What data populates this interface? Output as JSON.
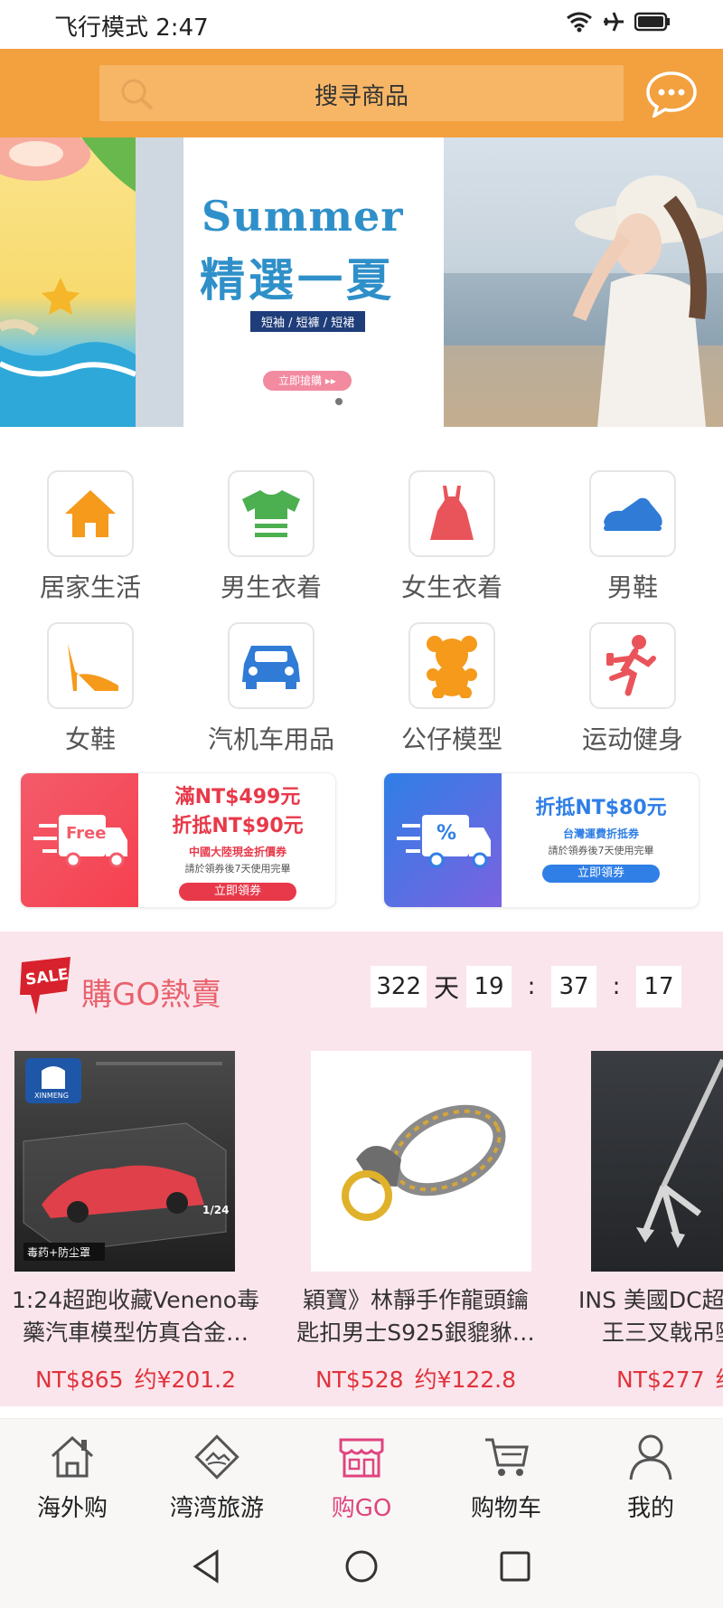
{
  "status_bar": {
    "text": "飞行模式 2:47",
    "icons": [
      "wifi-icon",
      "airplane-icon",
      "battery-icon"
    ]
  },
  "header": {
    "search_placeholder": "搜寻商品",
    "accent": "#f3a03f"
  },
  "banner": {
    "title_en": "Summer",
    "title_cn": "精選一夏",
    "tags": "短袖 / 短褲 / 短裙",
    "button": "立即搶購 ▸▸",
    "active_dot": 1
  },
  "categories": [
    {
      "label": "居家生活",
      "icon": "house-icon"
    },
    {
      "label": "男生衣着",
      "icon": "tshirt-icon"
    },
    {
      "label": "女生衣着",
      "icon": "dress-icon"
    },
    {
      "label": "男鞋",
      "icon": "sneaker-icon"
    },
    {
      "label": "女鞋",
      "icon": "high-heel-icon"
    },
    {
      "label": "汽机车用品",
      "icon": "car-icon"
    },
    {
      "label": "公仔模型",
      "icon": "teddy-bear-icon"
    },
    {
      "label": "运动健身",
      "icon": "runner-icon"
    }
  ],
  "coupons": [
    {
      "truck_label": "Free",
      "line1": "滿NT$499元",
      "line2": "折抵NT$90元",
      "sub": "中國大陸現金折價券",
      "note": "請於領券後7天使用完畢",
      "button": "立即領券"
    },
    {
      "truck_label": "%",
      "line1": "折抵NT$80元",
      "line2": "",
      "sub": "台灣運費折抵券",
      "note": "請於領券後7天使用完畢",
      "button": "立即領券"
    }
  ],
  "flash_sale": {
    "badge": "SALE",
    "title": "購GO熱賣",
    "countdown": {
      "days": "322",
      "days_unit": "天",
      "hours": "19",
      "minutes": "37",
      "seconds": "17"
    },
    "products": [
      {
        "name_line1": "1:24超跑收藏Veneno毒",
        "name_line2": "藥汽車模型仿真合金…",
        "price_ntd": "NT$865",
        "price_cny": "约¥201.2",
        "image_brand": "XINMENG",
        "image_caption": "毒药+防尘罩",
        "image_scale": "1/24"
      },
      {
        "name_line1": "穎寶》林靜手作龍頭鑰",
        "name_line2": "匙扣男士S925銀貔貅…",
        "price_ntd": "NT$528",
        "price_cny": "约¥122.8"
      },
      {
        "name_line1": "INS 美國DC超",
        "name_line2": "王三叉戟吊墜",
        "price_ntd": "NT$277",
        "price_cny": "约"
      }
    ]
  },
  "bottom_nav": [
    {
      "label": "海外购",
      "icon": "house-outline-icon"
    },
    {
      "label": "湾湾旅游",
      "icon": "travel-diamond-icon"
    },
    {
      "label": "购GO",
      "icon": "store-icon",
      "active": true
    },
    {
      "label": "购物车",
      "icon": "cart-icon"
    },
    {
      "label": "我的",
      "icon": "user-icon"
    }
  ],
  "colors": {
    "active_nav": "#e0447e",
    "price": "#e0333c",
    "sale_title": "#e8616c",
    "sale_bg": "#fbe5ec"
  }
}
